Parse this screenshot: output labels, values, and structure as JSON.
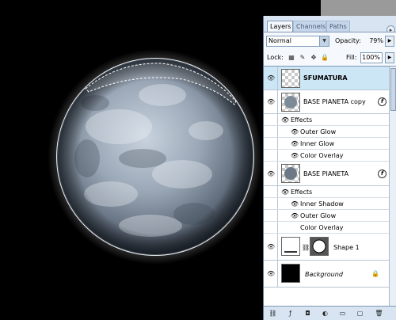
{
  "panel": {
    "tabs": [
      {
        "label": "Layers"
      },
      {
        "label": "Channels"
      },
      {
        "label": "Paths"
      }
    ],
    "blend_mode": "Normal",
    "opacity_label": "Opacity:",
    "opacity_value": "79%",
    "lock_label": "Lock:",
    "fill_label": "Fill:",
    "fill_value": "100%"
  },
  "layers": {
    "sfumatura": {
      "name": "SFUMATURA"
    },
    "base_copy": {
      "name": "BASE PIANETA copy",
      "effects_label": "Effects",
      "effects": [
        "Outer Glow",
        "Inner Glow",
        "Color Overlay"
      ]
    },
    "base": {
      "name": "BASE PIANETA",
      "effects_label": "Effects",
      "effects": [
        "Inner Shadow",
        "Outer Glow",
        "Color Overlay"
      ]
    },
    "shape": {
      "name": "Shape 1"
    },
    "background": {
      "name": "Background"
    }
  },
  "colors": {
    "panel_bg": "#d8e4f2",
    "selected_row": "#cde6f6",
    "canvas_bg": "#000000"
  }
}
